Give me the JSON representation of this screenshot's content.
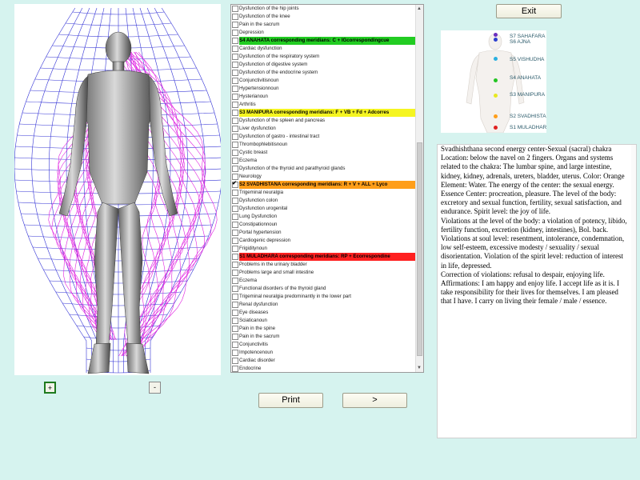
{
  "buttons": {
    "exit": "Exit",
    "print": "Print",
    "next": ">",
    "zoom_in": "+",
    "zoom_out": "-"
  },
  "conditions": [
    {
      "label": "Dysfunction of the hip joints",
      "checked": false
    },
    {
      "label": "Dysfunction of the knee",
      "checked": false
    },
    {
      "label": "Pain in the sacrum",
      "checked": false
    },
    {
      "label": "Depression",
      "checked": false
    },
    {
      "label": "S4 ANAHATA corresponding meridians: C + IGcorrespondingcue",
      "checked": false,
      "header": true,
      "color": "#22cc22"
    },
    {
      "label": "Cardiac dysfunction",
      "checked": false
    },
    {
      "label": "Dysfunction of the respiratory system",
      "checked": false
    },
    {
      "label": "Dysfunction of digestive system",
      "checked": false
    },
    {
      "label": "Dysfunction of the endocrine system",
      "checked": false
    },
    {
      "label": "Conjunctivitisnoun",
      "checked": false
    },
    {
      "label": "Hypertensionnoun",
      "checked": false
    },
    {
      "label": "Hysterianoun",
      "checked": false
    },
    {
      "label": "Arthritis",
      "checked": false
    },
    {
      "label": "S3 MANIPURA corresponding meridians: F + VB + Fd + Adcorres",
      "checked": false,
      "header": true,
      "color": "#f5f521"
    },
    {
      "label": "Dysfunction of the spleen and pancreas",
      "checked": false
    },
    {
      "label": "Liver dysfunction",
      "checked": false
    },
    {
      "label": "Dysfunction of gastro - intestinal tract",
      "checked": false
    },
    {
      "label": "Thrombophlebitisnoun",
      "checked": false
    },
    {
      "label": "Cystic breast",
      "checked": false
    },
    {
      "label": "Eczema",
      "checked": false
    },
    {
      "label": "Dysfunction of the thyroid and parathyroid glands",
      "checked": false
    },
    {
      "label": "Neurology",
      "checked": false
    },
    {
      "label": "S2 SVADHISTANA corresponding meridians: R + V + ALL + Lyco",
      "checked": true,
      "header": true,
      "color": "#ff9e1a"
    },
    {
      "label": "Trigeminal neuralgia",
      "checked": false
    },
    {
      "label": "Dysfunction colon",
      "checked": false
    },
    {
      "label": "Dysfunction urogenital",
      "checked": false
    },
    {
      "label": "Lung Dysfunction",
      "checked": false
    },
    {
      "label": "Constipationnoun",
      "checked": false
    },
    {
      "label": "Portal hypertension",
      "checked": false
    },
    {
      "label": "Cardiogenic depression",
      "checked": false
    },
    {
      "label": "Frigiditynoun",
      "checked": false
    },
    {
      "label": "S1 MULADHARA corresponding meridians: RP + Ecorrespondine",
      "checked": false,
      "header": true,
      "color": "#ff2020"
    },
    {
      "label": "Problems in the urinary bladder",
      "checked": false
    },
    {
      "label": "Problems large and small intestine",
      "checked": false
    },
    {
      "label": "Eczema",
      "checked": false
    },
    {
      "label": "Functional disorders of the thyroid gland",
      "checked": false
    },
    {
      "label": "Trigeminal neuralgia predominantly in the lower part",
      "checked": false
    },
    {
      "label": "Renal dysfunction",
      "checked": false
    },
    {
      "label": "Eye diseases",
      "checked": false
    },
    {
      "label": "Sciaticanoun",
      "checked": false
    },
    {
      "label": "Pain in the spine",
      "checked": false
    },
    {
      "label": "Pain in the sacrum",
      "checked": false
    },
    {
      "label": "Conjunctivitis",
      "checked": false
    },
    {
      "label": "Impotencenoun",
      "checked": false
    },
    {
      "label": "Cardiac disorder",
      "checked": false
    },
    {
      "label": "Endocrine",
      "checked": false
    }
  ],
  "chakras": [
    {
      "label": "S7 SAHAFARA",
      "color": "#6a2fbf"
    },
    {
      "label": "S6 AJNA",
      "color": "#2a3fcf"
    },
    {
      "label": "S5 VISHUDHA",
      "color": "#2ab0e0"
    },
    {
      "label": "S4 ANAHATA",
      "color": "#22c422"
    },
    {
      "label": "S3 MANIPURA",
      "color": "#e8e820"
    },
    {
      "label": "S2 SVADHISTANA",
      "color": "#ff9e1a"
    },
    {
      "label": "S1 MULADHARA",
      "color": "#e02020"
    }
  ],
  "description": "Svadhishthana second energy center-Sexual (sacral) chakra Location: below the navel on 2 fingers. Organs and systems related to the chakra: The lumbar spine, and large intestine, kidney, kidney, adrenals, ureters, bladder, uterus. Color: Orange Element: Water. The energy of the center: the sexual energy. Essence Center: procreation, pleasure. The level of the body: excretory and sexual function, fertility, sexual satisfaction, and endurance. Spirit level: the joy of life.\nViolations at the level of the body: a violation of potency, libido, fertility function, excretion (kidney, intestines), Bol. back.\nViolations at soul level: resentment, intolerance, condemnation, low self-esteem, excessive modesty / sexuality / sexual disorientation. Violation of the spirit level: reduction of interest in life, depressed.\nCorrection of violations: refusal to despair, enjoying life.\nAffirmations: I am happy and enjoy life. I accept life as it is. I take responsibility for their lives for themselves. I am pleased that I have. I carry on living their female / male / essence."
}
